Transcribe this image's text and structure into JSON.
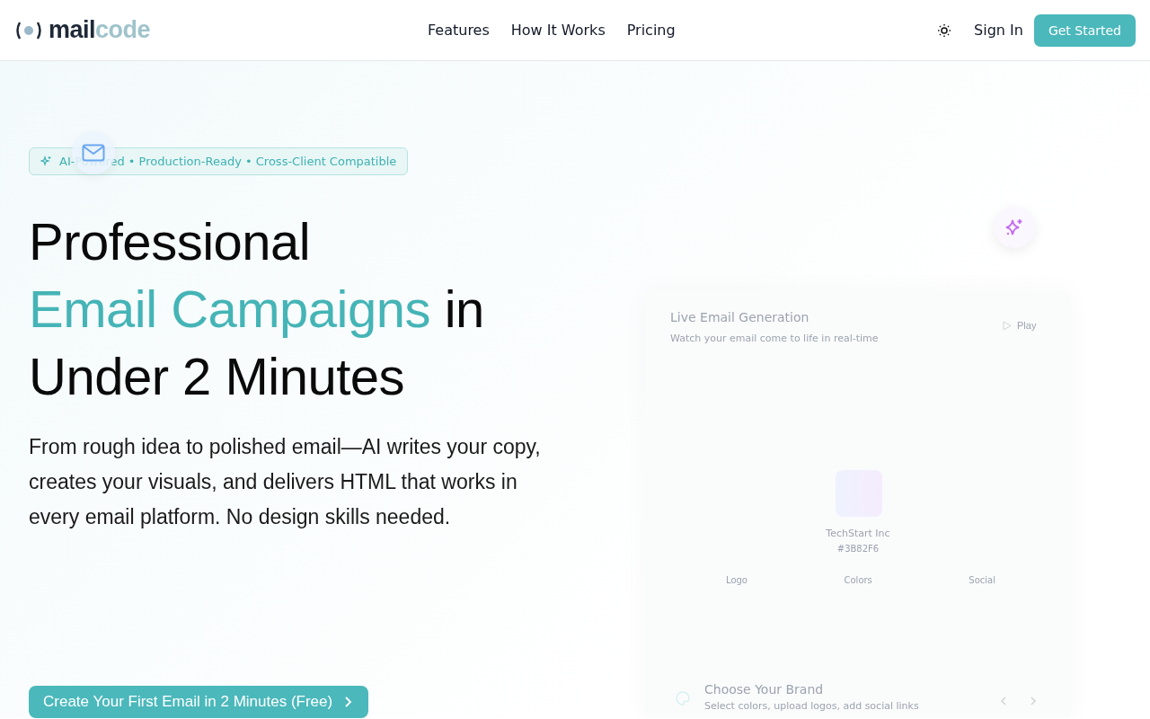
{
  "header": {
    "brand": {
      "part_1": "mail",
      "part_2": "code"
    },
    "nav": [
      {
        "label": "Features"
      },
      {
        "label": "How It Works"
      },
      {
        "label": "Pricing"
      }
    ],
    "sign_in": "Sign In",
    "cta": "Get Started"
  },
  "hero": {
    "badge": "AI-Powered • Production-Ready • Cross-Client Compatible",
    "headline": {
      "line_1": "Professional",
      "highlight": "Email Campaigns",
      "after_highlight": "in",
      "line_3": "Under 2 Minutes"
    },
    "subtitle": "From rough idea to polished email—AI writes your copy, creates your visuals, and delivers HTML that works in every email platform. No design skills needed.",
    "cta": "Create Your First Email in 2 Minutes (Free)"
  },
  "demo": {
    "title": "Live Email Generation",
    "subtitle": "Watch your email come to life in real-time",
    "play": "Play",
    "brand_name": "TechStart Inc",
    "brand_color": "#3B82F6",
    "tabs": [
      {
        "label": "Logo"
      },
      {
        "label": "Colors"
      },
      {
        "label": "Social"
      }
    ],
    "step": {
      "title": "Choose Your Brand",
      "description": "Select colors, upload logos, add social links"
    }
  }
}
